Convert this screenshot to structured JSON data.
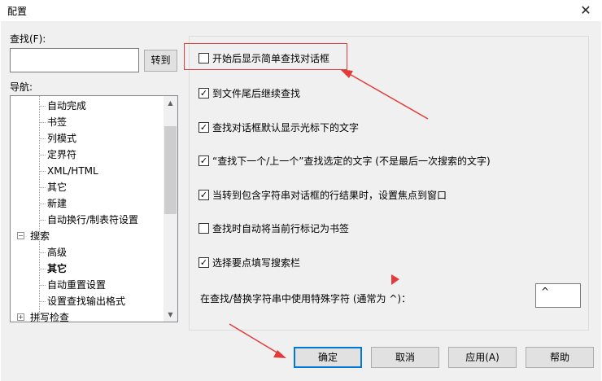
{
  "window": {
    "title": "配置",
    "close_glyph": "✕"
  },
  "find": {
    "label": "查找(F):",
    "value": "",
    "goto_label": "转到"
  },
  "nav": {
    "label": "导航:",
    "items": [
      {
        "label": "自动完成",
        "level": 2,
        "bold": false
      },
      {
        "label": "书签",
        "level": 2,
        "bold": false
      },
      {
        "label": "列模式",
        "level": 2,
        "bold": false
      },
      {
        "label": "定界符",
        "level": 2,
        "bold": false
      },
      {
        "label": "XML/HTML",
        "level": 2,
        "bold": false
      },
      {
        "label": "其它",
        "level": 2,
        "bold": false
      },
      {
        "label": "新建",
        "level": 2,
        "bold": false
      },
      {
        "label": "自动换行/制表符设置",
        "level": 2,
        "bold": false
      },
      {
        "label": "搜索",
        "level": 1,
        "bold": false,
        "expander": "−"
      },
      {
        "label": "高级",
        "level": 2,
        "bold": false
      },
      {
        "label": "其它",
        "level": 2,
        "bold": true
      },
      {
        "label": "自动重置设置",
        "level": 2,
        "bold": false
      },
      {
        "label": "设置查找输出格式",
        "level": 2,
        "bold": false
      },
      {
        "label": "拼写检查",
        "level": 1,
        "bold": false,
        "expander": "+"
      }
    ]
  },
  "options": [
    {
      "label": "开始后显示简单查找对话框",
      "checked": false
    },
    {
      "label": "到文件尾后继续查找",
      "checked": true
    },
    {
      "label": "查找对话框默认显示光标下的文字",
      "checked": true
    },
    {
      "label": "“查找下一个/上一个”查找选定的文字 (不是最后一次搜索的文字)",
      "checked": true
    },
    {
      "label": "当转到包含字符串对话框的行结果时，设置焦点到窗口",
      "checked": true
    },
    {
      "label": "查找时自动将当前行标记为书签",
      "checked": false
    },
    {
      "label": "选择要点填写搜索栏",
      "checked": true
    }
  ],
  "special": {
    "label": "在查找/替换字符串中使用特殊字符 (通常为 ^)：",
    "value": "^"
  },
  "buttons": {
    "ok": "确定",
    "cancel": "取消",
    "apply": "应用(A)",
    "help": "帮助"
  },
  "check_glyph": "✓",
  "colors": {
    "annotation_red": "#e23b3b",
    "focus_blue": "#0078d7"
  }
}
